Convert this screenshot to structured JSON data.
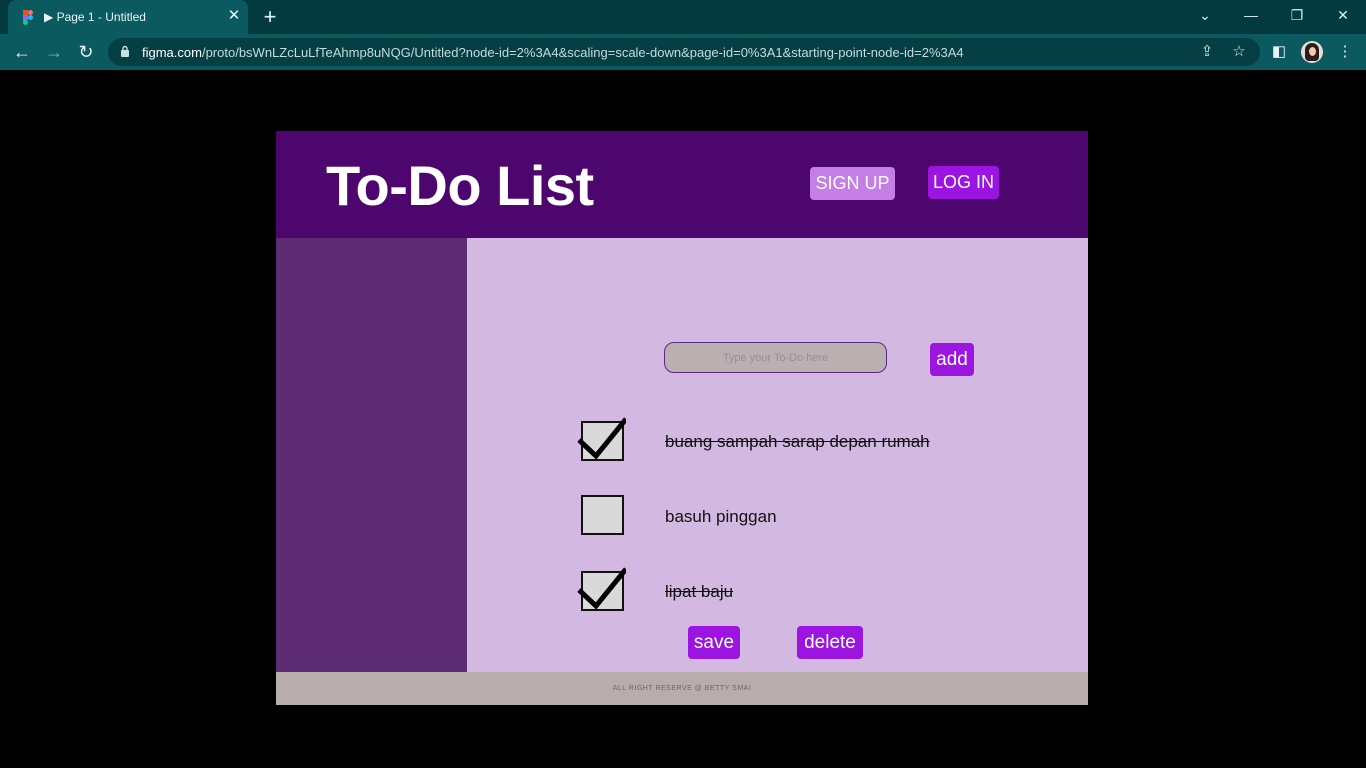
{
  "browser": {
    "tab_title": "▶ Page 1 - Untitled",
    "tab_close": "✕",
    "new_tab": "+",
    "url_host": "figma.com",
    "url_path": "/proto/bsWnLZcLuLfTeAhmp8uNQG/Untitled?node-id=2%3A4&scaling=scale-down&page-id=0%3A1&starting-point-node-id=2%3A4",
    "icons": [
      "figma-icon",
      "back-icon",
      "forward-icon",
      "reload-icon",
      "lock-icon",
      "share-icon",
      "star-icon",
      "sidepanel-icon",
      "avatar",
      "menu-icon",
      "tab-search-icon",
      "minimize-icon",
      "restore-icon",
      "close-icon"
    ]
  },
  "app": {
    "title": "To-Do List",
    "signup_label": "SIGN UP",
    "login_label": "LOG IN",
    "input_placeholder": "Type your To-Do here",
    "add_label": "add",
    "tasks": [
      {
        "text": "buang sampah sarap depan rumah",
        "done": true
      },
      {
        "text": "basuh pinggan",
        "done": false
      },
      {
        "text": "lipat baju",
        "done": true
      }
    ],
    "save_label": "save",
    "delete_label": "delete",
    "footer_text": "ALL RIGHT RESERVE @ BETTY SMAI"
  },
  "colors": {
    "chrome_tabbar": "#033a40",
    "chrome_toolbar": "#0a5a5f",
    "header": "#4d066d",
    "sidebar": "#5c2b73",
    "content": "#d3b9e1",
    "primary_button": "#9b14e0",
    "signup_button": "#c47ee6",
    "footer": "#b8adad"
  }
}
